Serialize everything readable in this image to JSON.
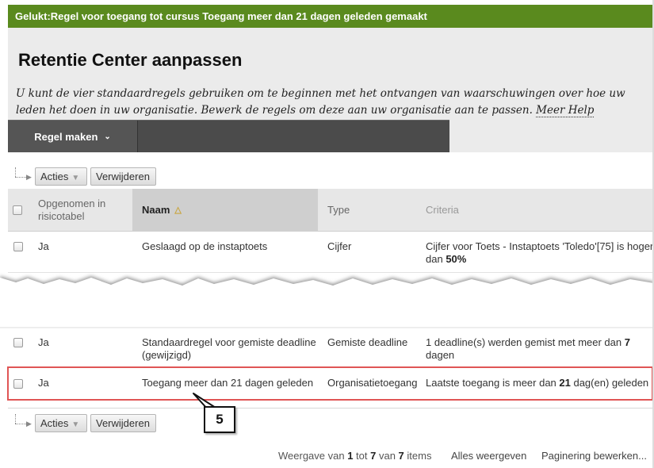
{
  "notification": {
    "text": "Gelukt:Regel voor toegang tot cursus Toegang meer dan 21 dagen geleden gemaakt"
  },
  "page": {
    "title": "Retentie Center aanpassen",
    "intro_text": "U kunt de vier standaardregels gebruiken om te beginnen met het ontvangen van waarschuwingen over hoe uw leden het doen in uw organisatie. Bewerk de regels om deze aan uw organisatie aan te passen.",
    "help_link": "Meer Help"
  },
  "action_bar": {
    "create_rule_label": "Regel maken"
  },
  "toolbar": {
    "actions_label": "Acties",
    "delete_label": "Verwijderen"
  },
  "table": {
    "headers": {
      "included": "Opgenomen in risicotabel",
      "name": "Naam",
      "type": "Type",
      "criteria": "Criteria"
    },
    "rows": [
      {
        "included": "Ja",
        "name": "Geslaagd op de instaptoets",
        "type": "Cijfer",
        "criteria_pre": "Cijfer voor Toets - Instaptoets 'Toledo'[75] is hoger dan ",
        "criteria_bold": "50%",
        "criteria_post": ""
      },
      {
        "included": "Ja",
        "name": "Standaardregel voor gemiste deadline (gewijzigd)",
        "type": "Gemiste deadline",
        "criteria_pre": "1 deadline(s) werden gemist met meer dan ",
        "criteria_bold": "7",
        "criteria_post": " dagen"
      },
      {
        "included": "Ja",
        "name": "Toegang meer dan 21 dagen geleden",
        "type": "Organisatietoegang",
        "criteria_pre": "Laatste toegang is meer dan ",
        "criteria_bold": "21",
        "criteria_post": " dag(en) geleden"
      }
    ]
  },
  "callout": {
    "number": "5"
  },
  "footer": {
    "count_prefix": "Weergave van ",
    "count_from": "1",
    "count_mid": " tot ",
    "count_to": "7",
    "count_mid2": " van ",
    "count_total": "7",
    "count_suffix": " items",
    "show_all": "Alles weergeven",
    "edit_paging": "Paginering bewerken..."
  },
  "colors": {
    "success": "#5a8a1e",
    "highlight": "#e05555",
    "action_bar": "#4b4b4b"
  }
}
